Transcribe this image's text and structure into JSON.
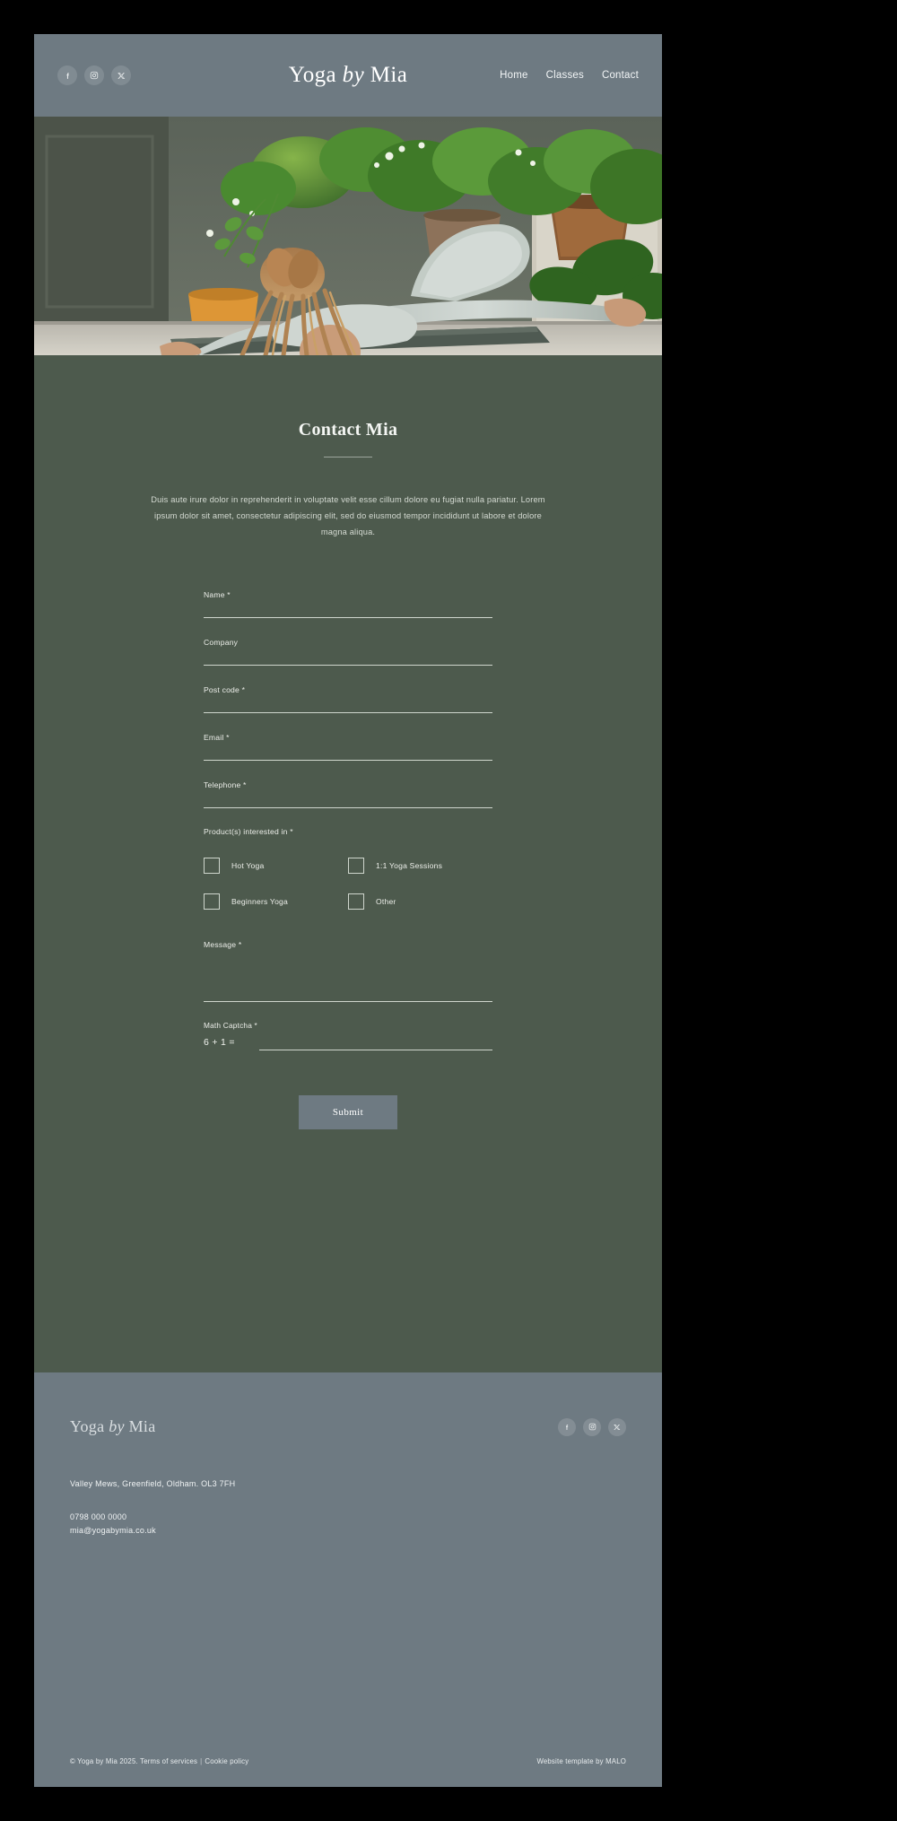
{
  "theme": {
    "page_background": "#000000",
    "header_background": "#6e7a82",
    "body_background": "#4d5a4d",
    "footer_background": "#6e7a82",
    "accent_text": "#ffffff",
    "line_color": "#cfd6cd"
  },
  "header": {
    "brand_part1": "Yoga",
    "brand_italic": "by",
    "brand_part2": "Mia",
    "social": [
      {
        "name": "facebook",
        "glyph": "f"
      },
      {
        "name": "instagram",
        "glyph": "instagram"
      },
      {
        "name": "x-twitter",
        "glyph": "X"
      }
    ],
    "nav": [
      {
        "label": "Home"
      },
      {
        "label": "Classes"
      },
      {
        "label": "Contact"
      }
    ]
  },
  "hero": {
    "alt": "Woman performing a yoga pose on a mat surrounded by house plants"
  },
  "contact": {
    "title": "Contact Mia",
    "intro": "Duis aute irure dolor in reprehenderit in voluptate velit esse cillum dolore eu fugiat nulla pariatur. Lorem ipsum dolor sit amet, consectetur adipiscing elit, sed do eiusmod tempor incididunt ut labore et dolore magna aliqua.",
    "fields": [
      {
        "label": "Name *",
        "value": "",
        "placeholder": ""
      },
      {
        "label": "Company",
        "value": "",
        "placeholder": ""
      },
      {
        "label": "Post code *",
        "value": "",
        "placeholder": ""
      },
      {
        "label": "Email *",
        "value": "",
        "placeholder": ""
      },
      {
        "label": "Telephone *",
        "value": "",
        "placeholder": ""
      }
    ],
    "products_label": "Product(s) interested in *",
    "products": [
      {
        "label": "Hot Yoga",
        "checked": false
      },
      {
        "label": "1:1 Yoga Sessions",
        "checked": false
      },
      {
        "label": "Beginners Yoga",
        "checked": false
      },
      {
        "label": "Other",
        "checked": false
      }
    ],
    "message_label": "Message *",
    "message_value": "",
    "captcha_label": "Math Captcha *",
    "captcha_equation": "6 + 1 =",
    "captcha_value": "",
    "submit_label": "Submit"
  },
  "footer": {
    "brand_part1": "Yoga",
    "brand_italic": "by",
    "brand_part2": "Mia",
    "social": [
      {
        "name": "facebook",
        "glyph": "f"
      },
      {
        "name": "instagram",
        "glyph": "instagram"
      },
      {
        "name": "x-twitter",
        "glyph": "X"
      }
    ],
    "address": "Valley Mews, Greenfield, Oldham. OL3 7FH",
    "phone": "0798 000 0000",
    "email": "mia@yogabymia.co.uk",
    "copyright": "© Yoga by Mia 2025. Terms of services",
    "separator": "|",
    "cookie_policy": "Cookie policy",
    "credit": "Website template  by MALO"
  }
}
